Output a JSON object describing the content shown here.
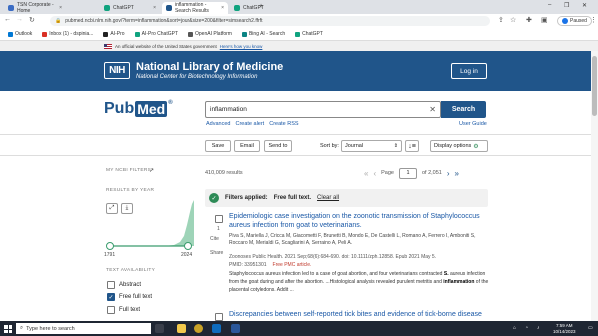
{
  "browser": {
    "tabs": [
      {
        "label": "TSN Corporate - Home",
        "favicon_color": "#3b6cc4",
        "active": false
      },
      {
        "label": "ChatGPT",
        "favicon_color": "#10a37f",
        "active": false
      },
      {
        "label": "inflammation - Search Results",
        "favicon_color": "#20558a",
        "active": true
      },
      {
        "label": "ChatGPT",
        "favicon_color": "#10a37f",
        "active": false
      }
    ],
    "new_tab": "+",
    "url": "pubmed.ncbi.nlm.nih.gov/?term=inflammation&sort=jour&size=200&filter=simsearch2.ffrft",
    "profile_label": "Paused",
    "bookmarks": [
      {
        "label": "Outlook",
        "color": "#0078d4"
      },
      {
        "label": "Inbox (1) - dspinia...",
        "color": "#d93025"
      },
      {
        "label": "AI-Pro",
        "color": "#222222"
      },
      {
        "label": "AI-Pro ChatGPT",
        "color": "#10a37f"
      },
      {
        "label": "OpenAI Platform",
        "color": "#555555"
      },
      {
        "label": "Bing AI - Search",
        "color": "#0c8484"
      },
      {
        "label": "ChatGPT",
        "color": "#10a37f"
      }
    ]
  },
  "gov_banner": {
    "text": "An official website of the United States government",
    "link": "Here's how you know"
  },
  "header": {
    "logo": "NIH",
    "title": "National Library of Medicine",
    "subtitle": "National Center for Biotechnology Information",
    "login": "Log in"
  },
  "search": {
    "logo_pub": "Pub",
    "logo_med": "Med",
    "logo_reg": "®",
    "query": "inflammation",
    "button": "Search",
    "links": [
      "Advanced",
      "Create alert",
      "Create RSS"
    ],
    "user_guide": "User Guide"
  },
  "actions": {
    "save": "Save",
    "email": "Email",
    "send_to": "Send to",
    "sort_label": "Sort by:",
    "sort_value": "Journal",
    "display_options": "Display options"
  },
  "sidebar": {
    "my_ncbi_filters": "MY NCBI FILTERS",
    "results_by_year": "RESULTS BY YEAR",
    "year_start": "1791",
    "year_end": "2024",
    "text_availability": "TEXT AVAILABILITY",
    "filters": [
      {
        "label": "Abstract",
        "checked": false
      },
      {
        "label": "Free full text",
        "checked": true
      },
      {
        "label": "Full text",
        "checked": false
      }
    ]
  },
  "results": {
    "count": "410,009 results",
    "page_label": "Page",
    "page_number": "1",
    "page_total": "of 2,051",
    "filters_applied_label": "Filters applied:",
    "filters_applied_value": "Free full text.",
    "clear_all": "Clear all",
    "items": [
      {
        "number": "1",
        "title": "Epidemiologic case investigation on the zoonotic transmission of Staphylococcus aureus infection from goat to veterinarians.",
        "authors": "Piva S, Mariella J, Cricca M, Giacometti F, Brunetti B, Mondo E, De Castelli L, Romano A, Ferrero I, Amboniti S, Roccaro M, Merialdi G, Scagliarini A, Serraino A, Peli A.",
        "journal": "Zoonoses Public Health. 2021 Sep;68(6):684-690. doi: 10.1111/zph.12858. Epub 2021 May 5.",
        "pmid": "PMID: 33951301",
        "free_pmc": "Free PMC article.",
        "cite": "Cite",
        "share": "Share",
        "snippet_1": "Staphylococcus aureus infection led to a case of goat abortion, and four veterinarians contracted ",
        "snippet_bold_1": "S.",
        "snippet_2": " aureus infection from the goat during and after the abortion. ...Histological analysis revealed purulent metritis and ",
        "snippet_bold_2": "inflammation",
        "snippet_3": " of the placental cotyledons. Addit ..."
      },
      {
        "number": "2",
        "title": "Discrepancies between self-reported tick bites and evidence of tick-borne disease"
      }
    ]
  },
  "taskbar": {
    "search_placeholder": "Type here to search",
    "time": "7:59 AM",
    "date": "10/14/2023"
  }
}
